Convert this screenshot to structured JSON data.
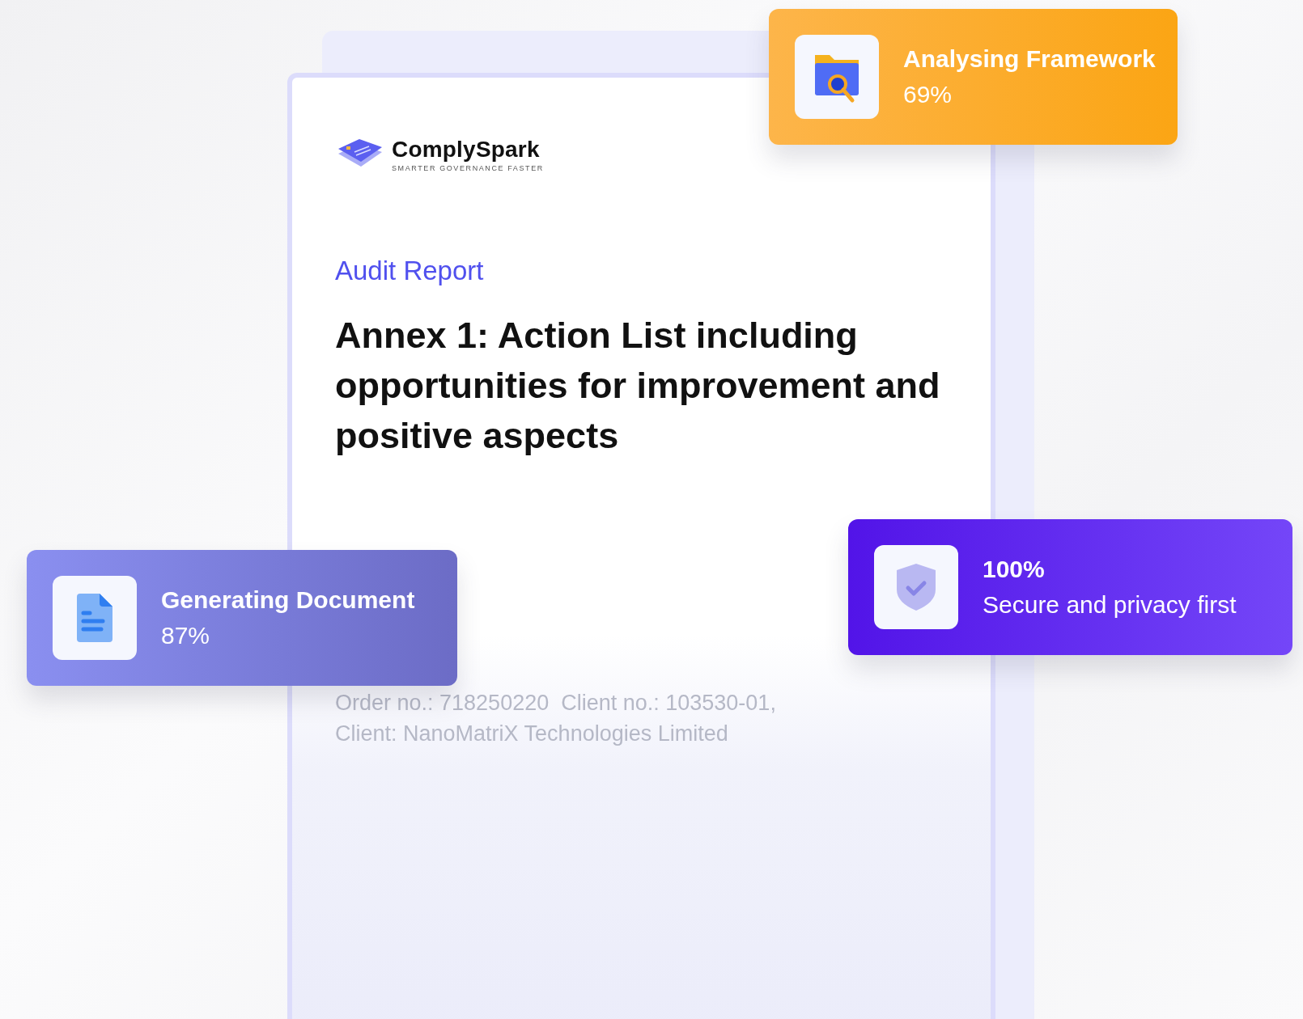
{
  "document": {
    "brand": {
      "name": "ComplySpark",
      "tagline": "SMARTER GOVERNANCE FASTER"
    },
    "kicker": "Audit Report",
    "title": "Annex 1: Action List including opportunities for improvement and positive aspects",
    "meta": [
      "Order no.: 718250220  Client no.: 103530-01,",
      "Client: NanoMatriX Technologies Limited"
    ]
  },
  "status_cards": [
    {
      "kind": "folder",
      "lines": [
        "Analysing Framework",
        "69%"
      ]
    },
    {
      "kind": "document",
      "lines": [
        "Generating Document",
        "87%"
      ]
    },
    {
      "kind": "shield",
      "lines": [
        "100%",
        "Secure and privacy first"
      ]
    }
  ]
}
